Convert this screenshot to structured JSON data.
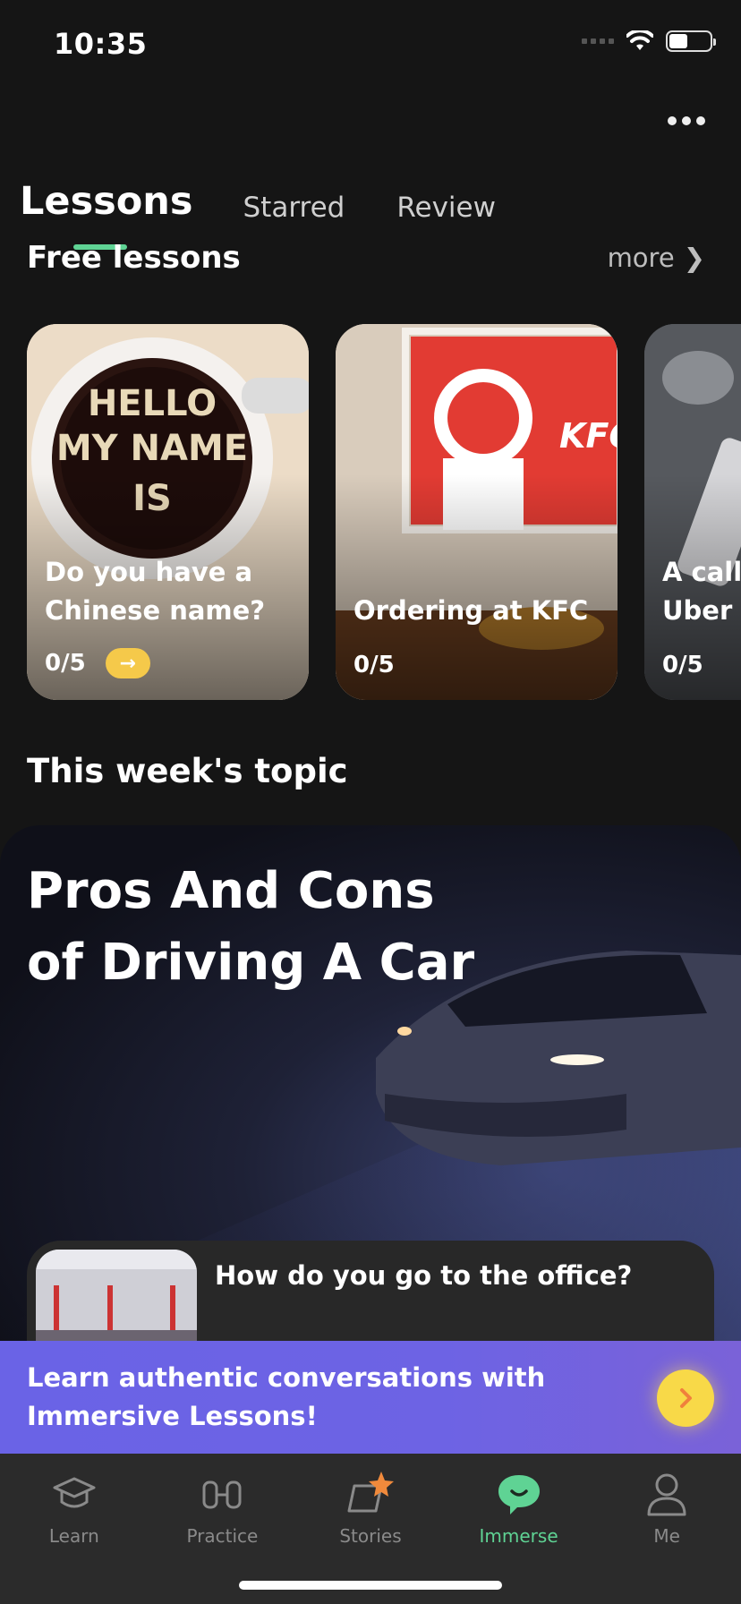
{
  "status": {
    "time": "10:35",
    "battery_level": 0.45
  },
  "tabs": [
    {
      "label": "Lessons",
      "active": true
    },
    {
      "label": "Starred",
      "active": false
    },
    {
      "label": "Review",
      "active": false
    }
  ],
  "free_lessons": {
    "title": "Free lessons",
    "more_label": "more",
    "cards": [
      {
        "title": "Do you have a Chinese name?",
        "progress": "0/5",
        "has_go": true,
        "image_text": [
          "HELLO",
          "MY NAME",
          "IS"
        ]
      },
      {
        "title": "Ordering at KFC",
        "progress": "0/5",
        "has_go": false,
        "image_text": [
          "KFC"
        ]
      },
      {
        "title": "A call Uber c",
        "progress": "0/5",
        "has_go": false
      }
    ]
  },
  "week": {
    "title": "This week's topic",
    "topic_title": "Pros And Cons of Driving A Car",
    "sub_lesson": "How do you go to the office?"
  },
  "banner": {
    "text": "Learn authentic conversations with Immersive Lessons!"
  },
  "nav": [
    {
      "label": "Learn",
      "icon": "graduation-cap-icon",
      "active": false
    },
    {
      "label": "Practice",
      "icon": "dumbbell-icon",
      "active": false
    },
    {
      "label": "Stories",
      "icon": "book-star-icon",
      "active": false
    },
    {
      "label": "Immerse",
      "icon": "chat-bubble-icon",
      "active": true
    },
    {
      "label": "Me",
      "icon": "person-icon",
      "active": false
    }
  ],
  "colors": {
    "accent": "#5fd394",
    "banner": "#6a63e6",
    "pill": "#f5c94a",
    "background": "#151515"
  }
}
